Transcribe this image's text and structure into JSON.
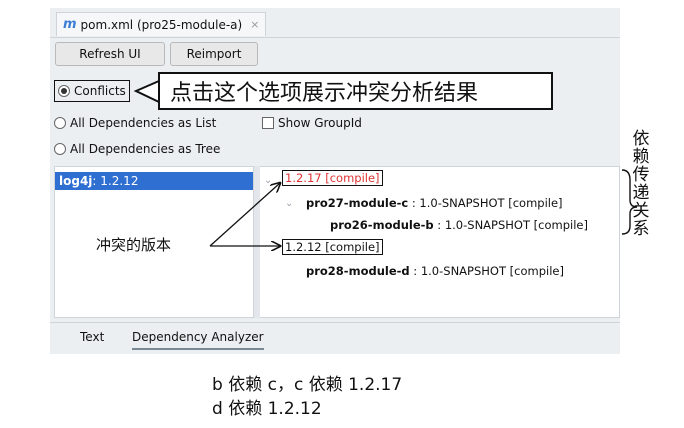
{
  "tab": {
    "icon": "m",
    "title": "pom.xml (pro25-module-a)",
    "close": "×"
  },
  "buttons": {
    "refresh": "Refresh UI",
    "reimport": "Reimport"
  },
  "options": {
    "conflicts": "Conflicts",
    "list": "All Dependencies as List",
    "show_group": "Show GroupId",
    "tree": "All Dependencies as Tree"
  },
  "callout": "点击这个选项展示冲突分析结果",
  "left_list": {
    "name": "log4j",
    "version": " : 1.2.12"
  },
  "tree": [
    {
      "text": "1.2.17 [compile]"
    },
    {
      "name": "pro27-module-c",
      "detail": " : 1.0-SNAPSHOT [compile]"
    },
    {
      "name": "pro26-module-b",
      "detail": " : 1.0-SNAPSHOT [compile]"
    },
    {
      "text": "1.2.12 [compile]"
    },
    {
      "name": "pro28-module-d",
      "detail": " : 1.0-SNAPSHOT [compile]"
    }
  ],
  "annotations": {
    "conflict_version": "冲突的版本",
    "transitive": "依赖传递关系"
  },
  "bottom_tabs": {
    "text": "Text",
    "analyzer": "Dependency Analyzer"
  },
  "captions": {
    "line1": "b 依赖 c，c 依赖 1.2.17",
    "line2": "d 依赖 1.2.12"
  },
  "colors": {
    "selection": "#2f6fd1",
    "conflict_red": "#e03333"
  }
}
